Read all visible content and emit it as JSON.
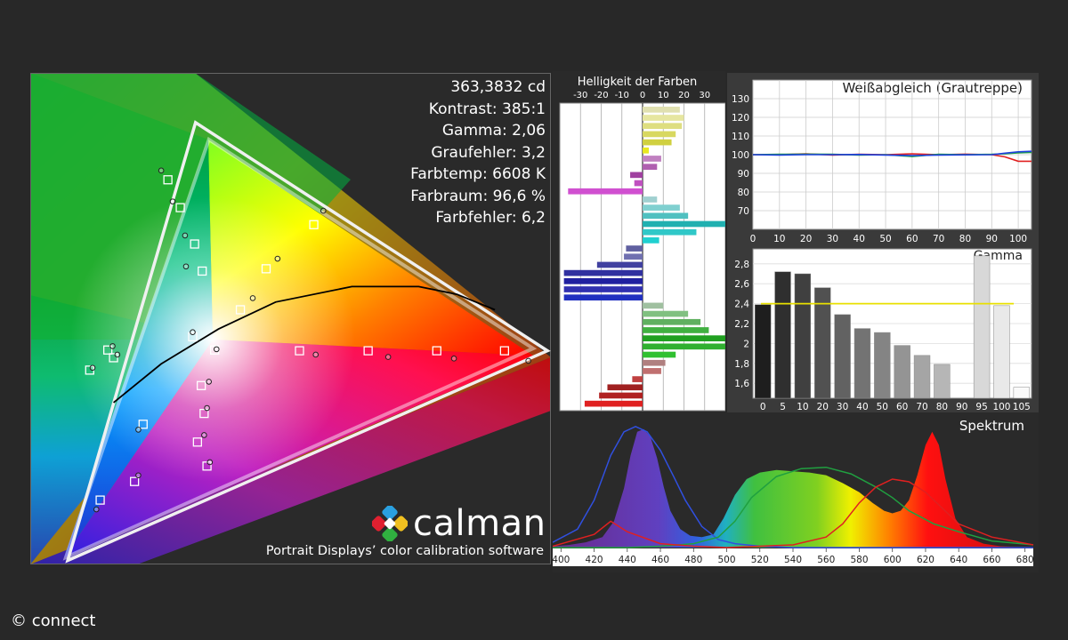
{
  "stats": {
    "luminance": "363,3832 cd",
    "contrast": "Kontrast: 385:1",
    "gamma": "Gamma: 2,06",
    "gray_error": "Graufehler: 3,2",
    "color_temp": "Farbtemp: 6608 K",
    "color_space": "Farbraum: 96,6 %",
    "color_error": "Farbfehler: 6,2"
  },
  "branding": {
    "logo_word": "calman",
    "tagline": "Portrait Displays’ color calibration software"
  },
  "copyright": "© connect",
  "colors": {
    "background": "#282828",
    "gamma_target": "#e8e000",
    "wb_red": "#e02020",
    "wb_green": "#20a040",
    "wb_blue": "#2040e0"
  },
  "chart_data": [
    {
      "type": "bar",
      "title": "Helligkeit der Farben",
      "orientation": "horizontal",
      "xticks": [
        "-30",
        "-20",
        "-10",
        "0",
        "10",
        "20",
        "30"
      ],
      "xlim": [
        -40,
        40
      ],
      "bars": [
        {
          "value": 18,
          "color": "#e0e0b0"
        },
        {
          "value": 20,
          "color": "#e6e6a0"
        },
        {
          "value": 19,
          "color": "#dede80"
        },
        {
          "value": 16,
          "color": "#d8d860"
        },
        {
          "value": 14,
          "color": "#d0d040"
        },
        {
          "value": 3,
          "color": "#e8e820"
        },
        {
          "value": 9,
          "color": "#c080c0"
        },
        {
          "value": 7,
          "color": "#b060b0"
        },
        {
          "value": -6,
          "color": "#a040a0"
        },
        {
          "value": -4,
          "color": "#c050c0"
        },
        {
          "value": -36,
          "color": "#d050d0"
        },
        {
          "value": 7,
          "color": "#a0d0d0"
        },
        {
          "value": 18,
          "color": "#80d0d0"
        },
        {
          "value": 22,
          "color": "#50c0c0"
        },
        {
          "value": 40,
          "color": "#20b0b0"
        },
        {
          "value": 26,
          "color": "#30c8c8"
        },
        {
          "value": 8,
          "color": "#20d0d0"
        },
        {
          "value": -8,
          "color": "#6060a0"
        },
        {
          "value": -9,
          "color": "#7070b0"
        },
        {
          "value": -22,
          "color": "#4040a0"
        },
        {
          "value": -38,
          "color": "#3030a0"
        },
        {
          "value": -38,
          "color": "#2020a0"
        },
        {
          "value": -38,
          "color": "#3030b0"
        },
        {
          "value": -38,
          "color": "#2030c0"
        },
        {
          "value": 10,
          "color": "#a0c0a0"
        },
        {
          "value": 22,
          "color": "#80c080"
        },
        {
          "value": 28,
          "color": "#60b060"
        },
        {
          "value": 32,
          "color": "#40b040"
        },
        {
          "value": 40,
          "color": "#20a020"
        },
        {
          "value": 40,
          "color": "#30b030"
        },
        {
          "value": 16,
          "color": "#30c030"
        },
        {
          "value": 11,
          "color": "#b08080"
        },
        {
          "value": 9,
          "color": "#c07070"
        },
        {
          "value": -5,
          "color": "#c04040"
        },
        {
          "value": -17,
          "color": "#a02020"
        },
        {
          "value": -21,
          "color": "#b02020"
        },
        {
          "value": -28,
          "color": "#e02020"
        }
      ]
    },
    {
      "type": "line",
      "title": "Weißabgleich (Grautreppe)",
      "x": [
        0,
        10,
        20,
        30,
        40,
        50,
        60,
        70,
        80,
        90,
        95,
        100,
        105
      ],
      "ylim": [
        60,
        140
      ],
      "xticks": [
        "0",
        "10",
        "20",
        "30",
        "40",
        "50",
        "60",
        "70",
        "80",
        "90",
        "100"
      ],
      "yticks": [
        "70",
        "80",
        "90",
        "100",
        "110",
        "120",
        "130"
      ],
      "series": [
        {
          "color": "#e02020",
          "values": [
            100,
            100,
            100.5,
            99.8,
            100.2,
            100,
            100.5,
            100,
            100.3,
            100,
            98.8,
            96.5,
            96.5
          ]
        },
        {
          "color": "#20a040",
          "values": [
            100,
            100.2,
            100.3,
            100.2,
            99.8,
            100,
            99,
            100.2,
            100,
            100.2,
            100.5,
            101,
            101.2
          ]
        },
        {
          "color": "#2040e0",
          "values": [
            100,
            99.8,
            100,
            100,
            100.1,
            99.8,
            99.5,
            99.8,
            99.9,
            100,
            100.8,
            101.5,
            101.8
          ]
        }
      ]
    },
    {
      "type": "bar",
      "title": "Gamma",
      "categories": [
        "0",
        "5",
        "10",
        "20",
        "30",
        "40",
        "50",
        "60",
        "70",
        "80",
        "90",
        "95",
        "100",
        "105"
      ],
      "values": [
        2.39,
        2.72,
        2.7,
        2.56,
        2.29,
        2.15,
        2.11,
        1.98,
        1.88,
        1.79,
        null,
        2.88,
        2.38,
        1.56
      ],
      "target": 2.4,
      "ylim": [
        1.45,
        2.95
      ],
      "yticks": [
        "1,6",
        "1,8",
        "2",
        "2,2",
        "2,4",
        "2,6",
        "2,8"
      ]
    },
    {
      "type": "line",
      "title": "Spektrum",
      "xticks": [
        "400",
        "420",
        "440",
        "460",
        "480",
        "500",
        "520",
        "540",
        "560",
        "580",
        "600",
        "620",
        "640",
        "660",
        "680"
      ],
      "xlim": [
        395,
        685
      ],
      "measured": {
        "x": [
          395,
          405,
          415,
          425,
          432,
          438,
          442,
          446,
          450,
          454,
          458,
          462,
          466,
          472,
          478,
          485,
          492,
          498,
          505,
          512,
          520,
          530,
          540,
          550,
          560,
          570,
          580,
          588,
          595,
          600,
          605,
          610,
          615,
          620,
          624,
          628,
          632,
          638,
          645,
          655,
          665,
          685
        ],
        "y": [
          1,
          2,
          4,
          8,
          20,
          45,
          70,
          88,
          90,
          84,
          68,
          46,
          28,
          14,
          9,
          8,
          10,
          22,
          40,
          52,
          57,
          59,
          58,
          57,
          55,
          49,
          42,
          34,
          28,
          26,
          28,
          36,
          55,
          78,
          88,
          78,
          52,
          22,
          8,
          3,
          1,
          0
        ]
      },
      "reference": [
        {
          "color": "#3050e0",
          "x": [
            395,
            410,
            420,
            430,
            438,
            445,
            452,
            460,
            468,
            475,
            485,
            495,
            505,
            520,
            540,
            560,
            580,
            600,
            620,
            640,
            660,
            685
          ],
          "y": [
            4,
            14,
            36,
            70,
            88,
            92,
            88,
            74,
            54,
            36,
            16,
            6,
            3,
            1,
            0,
            0,
            0,
            0,
            0,
            0,
            0,
            0
          ]
        },
        {
          "color": "#20a040",
          "x": [
            395,
            420,
            440,
            460,
            480,
            495,
            505,
            515,
            530,
            545,
            560,
            575,
            590,
            600,
            610,
            625,
            640,
            660,
            685
          ],
          "y": [
            0,
            0,
            0,
            1,
            3,
            8,
            20,
            38,
            54,
            60,
            61,
            56,
            46,
            38,
            28,
            18,
            12,
            5,
            2
          ]
        },
        {
          "color": "#e02020",
          "x": [
            395,
            420,
            430,
            440,
            460,
            480,
            500,
            520,
            540,
            560,
            570,
            580,
            590,
            600,
            610,
            620,
            630,
            640,
            660,
            685
          ],
          "y": [
            1,
            10,
            20,
            12,
            3,
            1,
            0,
            1,
            2,
            8,
            18,
            34,
            46,
            52,
            50,
            42,
            30,
            18,
            8,
            2
          ]
        }
      ]
    },
    {
      "type": "scatter",
      "title": "",
      "xlim": [
        0,
        0.75
      ],
      "ylim": [
        0,
        0.85
      ],
      "gamut_target": [
        [
          0.64,
          0.33
        ],
        [
          0.3,
          0.6
        ],
        [
          0.15,
          0.06
        ]
      ],
      "gamut_measured": [
        [
          0.655,
          0.327
        ],
        [
          0.286,
          0.622
        ],
        [
          0.152,
          0.056
        ]
      ],
      "targets": [
        [
          0.306,
          0.328
        ],
        [
          0.292,
          0.282
        ],
        [
          0.295,
          0.246
        ],
        [
          0.288,
          0.209
        ],
        [
          0.298,
          0.178
        ],
        [
          0.222,
          0.158
        ],
        [
          0.186,
          0.134
        ],
        [
          0.175,
          0.302
        ],
        [
          0.2,
          0.318
        ],
        [
          0.231,
          0.232
        ],
        [
          0.283,
          0.345
        ],
        [
          0.293,
          0.43
        ],
        [
          0.285,
          0.465
        ],
        [
          0.27,
          0.512
        ],
        [
          0.257,
          0.548
        ],
        [
          0.395,
          0.327
        ],
        [
          0.467,
          0.327
        ],
        [
          0.539,
          0.327
        ],
        [
          0.61,
          0.327
        ],
        [
          0.41,
          0.49
        ],
        [
          0.36,
          0.433
        ],
        [
          0.333,
          0.38
        ],
        [
          0.194,
          0.328
        ]
      ],
      "measured": [
        [
          0.308,
          0.329
        ],
        [
          0.3,
          0.287
        ],
        [
          0.298,
          0.253
        ],
        [
          0.295,
          0.218
        ],
        [
          0.301,
          0.183
        ],
        [
          0.226,
          0.166
        ],
        [
          0.182,
          0.122
        ],
        [
          0.178,
          0.305
        ],
        [
          0.204,
          0.322
        ],
        [
          0.226,
          0.225
        ],
        [
          0.283,
          0.351
        ],
        [
          0.276,
          0.436
        ],
        [
          0.275,
          0.476
        ],
        [
          0.262,
          0.52
        ],
        [
          0.25,
          0.56
        ],
        [
          0.412,
          0.322
        ],
        [
          0.488,
          0.319
        ],
        [
          0.557,
          0.317
        ],
        [
          0.635,
          0.314
        ],
        [
          0.42,
          0.508
        ],
        [
          0.372,
          0.446
        ],
        [
          0.346,
          0.395
        ],
        [
          0.199,
          0.333
        ]
      ],
      "blackbody": {
        "x": [
          0.2,
          0.25,
          0.31,
          0.37,
          0.45,
          0.52,
          0.56,
          0.6
        ],
        "y": [
          0.26,
          0.31,
          0.355,
          0.39,
          0.41,
          0.41,
          0.4,
          0.38
        ]
      }
    }
  ]
}
